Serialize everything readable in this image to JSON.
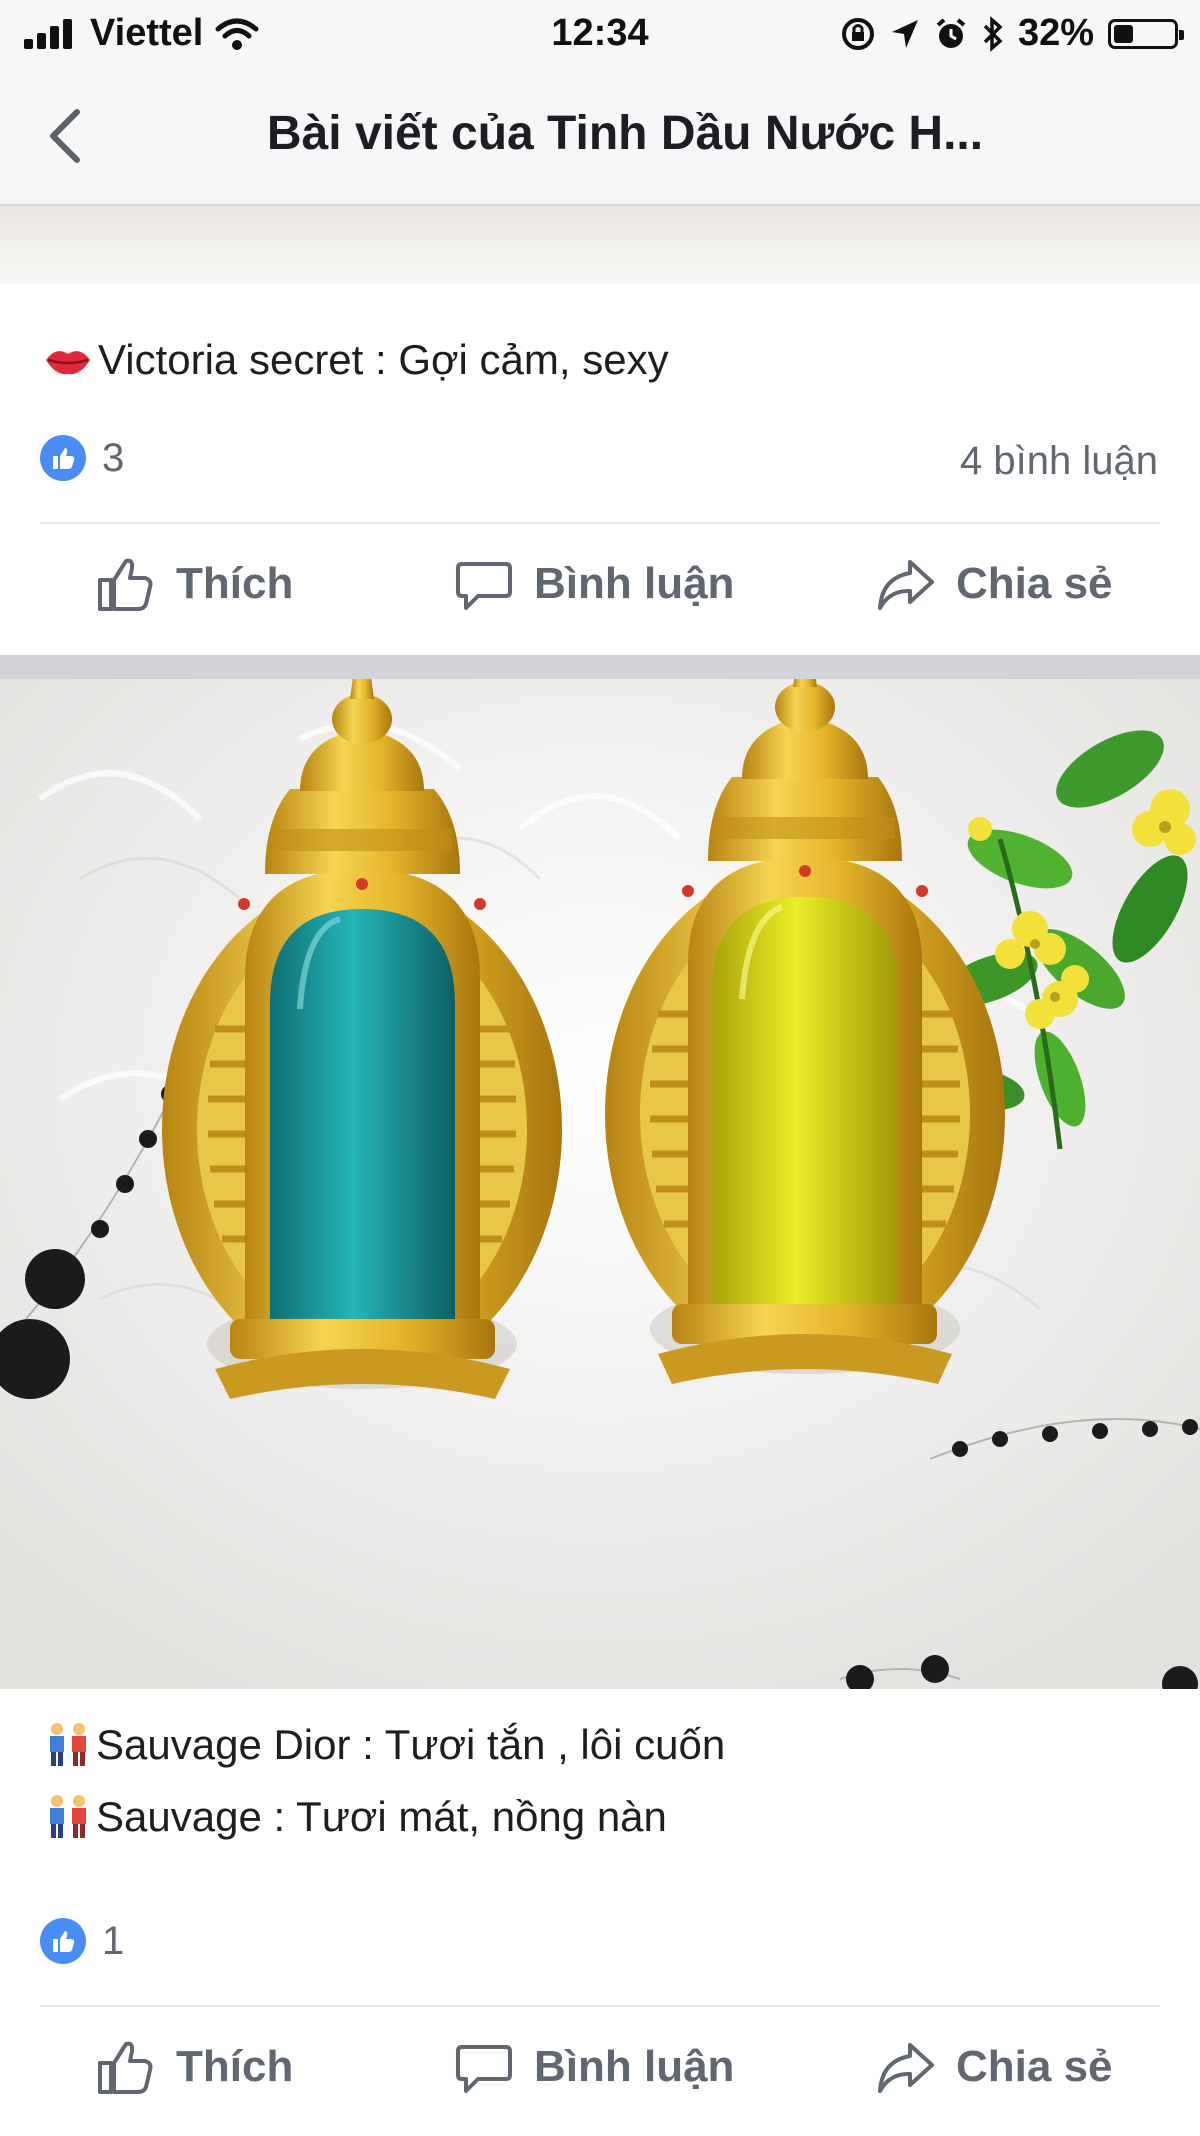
{
  "status_bar": {
    "carrier": "Viettel",
    "time": "12:34",
    "battery_percent": "32%",
    "battery_level": 0.32
  },
  "nav": {
    "title": "Bài viết của Tinh Dầu Nước H..."
  },
  "post1": {
    "text": "Victoria  secret : Gợi cảm, sexy",
    "like_count": "3",
    "comment_count": "4 bình luận"
  },
  "actions": {
    "like": "Thích",
    "comment": "Bình luận",
    "share": "Chia sẻ"
  },
  "post2": {
    "line1": "Sauvage Dior : Tươi tắn , lôi cuốn",
    "line2": "Sauvage  : Tươi mát, nồng nàn",
    "like_count": "1"
  },
  "colors": {
    "like_blue": "#4a8df6",
    "teal_liquid": "#1aa0a6",
    "yellow_liquid": "#d8dc10",
    "gold": "#e4b62a"
  },
  "icons": [
    "signal-icon",
    "wifi-icon",
    "lock-rotation-icon",
    "location-icon",
    "alarm-icon",
    "bluetooth-icon",
    "battery-icon",
    "back-chevron-icon",
    "lips-emoji-icon",
    "couple-emoji-icon",
    "like-badge-icon",
    "thumbs-up-icon",
    "comment-icon",
    "share-icon"
  ]
}
